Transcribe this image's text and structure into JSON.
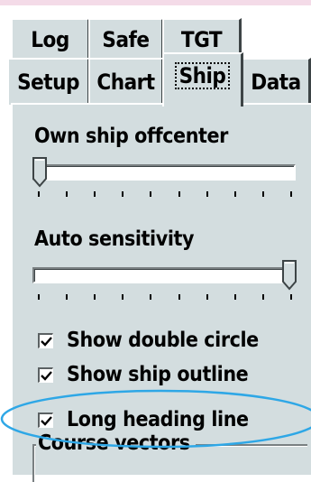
{
  "tabs": {
    "row1": [
      {
        "label": "Log"
      },
      {
        "label": "Safe"
      },
      {
        "label": "TGT"
      }
    ],
    "row2": [
      {
        "label": "Setup"
      },
      {
        "label": "Chart"
      },
      {
        "label": "Ship",
        "active": true
      },
      {
        "label": "Data"
      }
    ]
  },
  "ship_tab": {
    "own_ship_offcenter": {
      "label": "Own ship offcenter",
      "value_fraction": 0.0,
      "tick_count": 10
    },
    "auto_sensitivity": {
      "label": "Auto sensitivity",
      "value_fraction": 1.0,
      "tick_count": 10
    },
    "checkboxes": [
      {
        "label": "Show double circle",
        "checked": true
      },
      {
        "label": "Show ship outline",
        "checked": true
      },
      {
        "label": "Long heading line",
        "checked": true,
        "highlighted": true
      }
    ],
    "course_vectors_group": {
      "label": "Course vectors"
    }
  },
  "colors": {
    "panel_bg": "#d3dddf",
    "highlight_oval": "#2ea7e6",
    "pink_edge": "#f4dbe8"
  }
}
